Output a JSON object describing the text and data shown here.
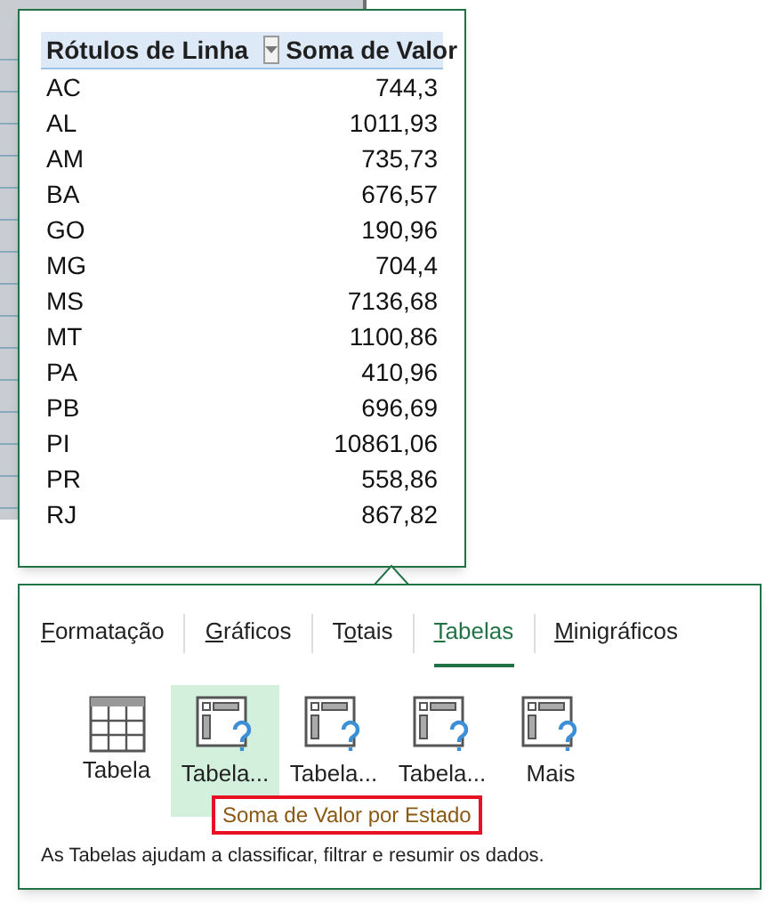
{
  "pivot_preview": {
    "columns": [
      "Rótulos de Linha",
      "Soma de Valor"
    ],
    "rows": [
      {
        "label": "AC",
        "value": "744,3"
      },
      {
        "label": "AL",
        "value": "1011,93"
      },
      {
        "label": "AM",
        "value": "735,73"
      },
      {
        "label": "BA",
        "value": "676,57"
      },
      {
        "label": "GO",
        "value": "190,96"
      },
      {
        "label": "MG",
        "value": "704,4"
      },
      {
        "label": "MS",
        "value": "7136,68"
      },
      {
        "label": "MT",
        "value": "1100,86"
      },
      {
        "label": "PA",
        "value": "410,96"
      },
      {
        "label": "PB",
        "value": "696,69"
      },
      {
        "label": "PI",
        "value": "10861,06"
      },
      {
        "label": "PR",
        "value": "558,86"
      },
      {
        "label": "RJ",
        "value": "867,82"
      }
    ]
  },
  "quick_analysis": {
    "tabs": [
      {
        "access_key": "F",
        "rest": "ormatação",
        "selected": false
      },
      {
        "access_key": "G",
        "rest": "ráficos",
        "selected": false
      },
      {
        "lead": "T",
        "access_key": "o",
        "rest": "tais",
        "selected": false
      },
      {
        "access_key": "T",
        "rest": "abelas",
        "selected": true
      },
      {
        "access_key": "M",
        "rest": "inigráficos",
        "selected": false
      }
    ],
    "options": [
      {
        "kind": "table",
        "label": "Tabela",
        "selected": false
      },
      {
        "kind": "pivot",
        "label": "Tabela...",
        "selected": true
      },
      {
        "kind": "pivot",
        "label": "Tabela...",
        "selected": false
      },
      {
        "kind": "pivot",
        "label": "Tabela...",
        "selected": false
      },
      {
        "kind": "pivot",
        "label": "Mais",
        "selected": false
      }
    ],
    "tooltip": "Soma de Valor por Estado",
    "description": "As Tabelas ajudam a classificar, filtrar e resumir os dados."
  }
}
